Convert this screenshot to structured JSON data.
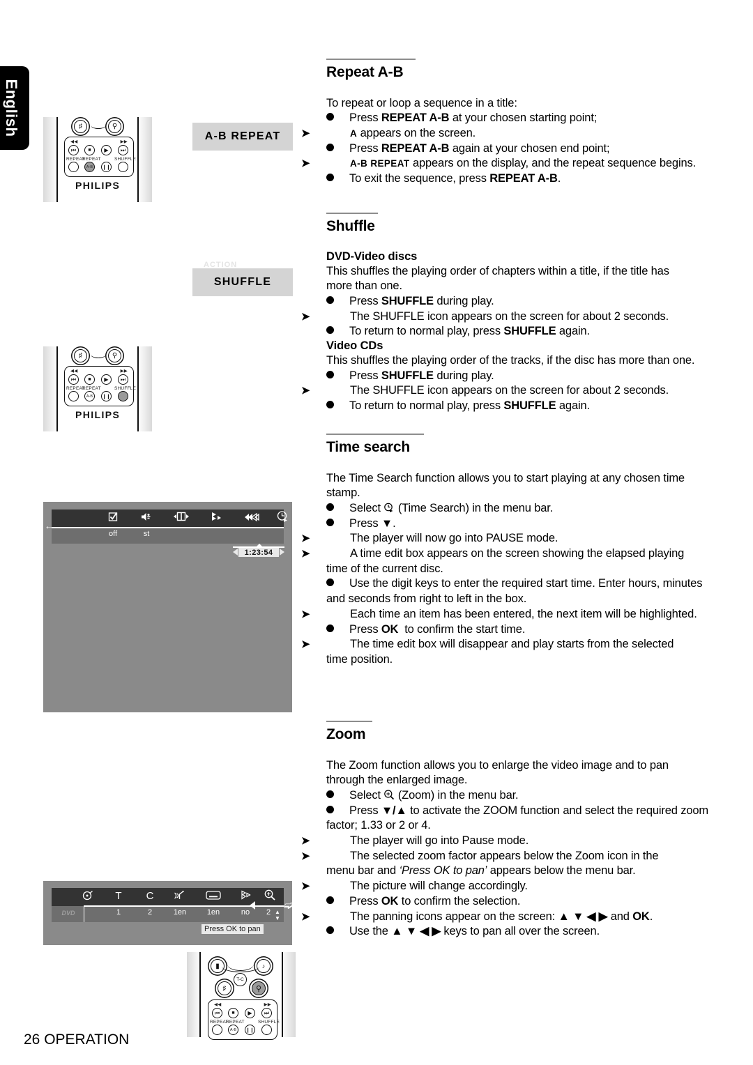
{
  "page": {
    "language_tab": "English",
    "footer": "26 OPERATION",
    "footer_page_number": "26",
    "footer_section": "OPERATION"
  },
  "sections": [
    {
      "id": "repeat-ab",
      "title": "Repeat A-B",
      "lines": [
        {
          "kind": "plain",
          "text": "To repeat or loop a sequence in a title:"
        },
        {
          "kind": "bullet",
          "text": "Press REPEAT A-B at your chosen starting point;",
          "bold": "REPEAT A-B"
        },
        {
          "kind": "arrow",
          "text": "A appears on the screen.",
          "smallcaps": "A"
        },
        {
          "kind": "bullet",
          "text": "Press REPEAT A-B again at your chosen end point;",
          "bold": "REPEAT A-B"
        },
        {
          "kind": "arrow",
          "text": "A-B REPEAT appears on the display, and the repeat sequence begins.",
          "smallcaps": "A-B REPEAT"
        },
        {
          "kind": "bullet",
          "text": "To exit the sequence, press REPEAT A-B.",
          "bold": "REPEAT A-B"
        }
      ]
    },
    {
      "id": "shuffle",
      "title": "Shuffle",
      "subheads": [
        "DVD-Video discs",
        "Video CDs"
      ],
      "lines": [
        {
          "kind": "subhead",
          "text": "DVD-Video discs"
        },
        {
          "kind": "plain",
          "text": "This shuffles the playing order of chapters within a title, if the title has"
        },
        {
          "kind": "plain",
          "text": "more than one."
        },
        {
          "kind": "bullet",
          "text": "Press SHUFFLE during play.",
          "bold": "SHUFFLE"
        },
        {
          "kind": "arrow",
          "text": "The SHUFFLE icon appears on the screen for about 2 seconds."
        },
        {
          "kind": "bullet",
          "text": "To return to normal play, press SHUFFLE again.",
          "bold": "SHUFFLE"
        },
        {
          "kind": "subhead",
          "text": "Video CDs"
        },
        {
          "kind": "plain",
          "text": "This shuffles the playing order of the tracks, if the disc has more  than one."
        },
        {
          "kind": "bullet",
          "text": "Press SHUFFLE during play.",
          "bold": "SHUFFLE"
        },
        {
          "kind": "arrow",
          "text": "The SHUFFLE icon appears on the screen for about 2 seconds."
        },
        {
          "kind": "bullet",
          "text": "To return to normal play, press SHUFFLE again.",
          "bold": "SHUFFLE"
        }
      ]
    },
    {
      "id": "time-search",
      "title": "Time search",
      "lines": [
        {
          "kind": "plain",
          "text": "The Time Search function allows you to start playing at any chosen time"
        },
        {
          "kind": "plain",
          "text": "stamp."
        },
        {
          "kind": "bullet",
          "text": "Select  (Time Search) in the menu bar.",
          "icon": "time-search-icon"
        },
        {
          "kind": "bullet",
          "text": "Press ▼."
        },
        {
          "kind": "arrow",
          "text": "The player will now go into PAUSE mode."
        },
        {
          "kind": "arrow",
          "text": "A time edit box appears on the screen showing the elapsed playing"
        },
        {
          "kind": "plain",
          "text": "time of the current disc."
        },
        {
          "kind": "bullet",
          "text": "Use the digit keys to enter the required start time. Enter hours, minutes"
        },
        {
          "kind": "plain",
          "text": "and seconds from right to left in the box."
        },
        {
          "kind": "arrow",
          "text": "Each time an item has been entered, the next item will be highlighted."
        },
        {
          "kind": "bullet",
          "text": "Press OK  to confirm the start time.",
          "bold": "OK"
        },
        {
          "kind": "arrow",
          "text": "The time edit box will disappear and play starts from the selected"
        },
        {
          "kind": "plain",
          "text": "time position."
        }
      ]
    },
    {
      "id": "zoom",
      "title": "Zoom",
      "lines": [
        {
          "kind": "plain",
          "text": "The Zoom function allows you to enlarge the video image and to pan"
        },
        {
          "kind": "plain",
          "text": "through the enlarged image."
        },
        {
          "kind": "bullet",
          "text": "Select  (Zoom) in the menu bar.",
          "icon": "zoom-icon"
        },
        {
          "kind": "bullet",
          "text": "Press ▼/▲ to activate the ZOOM function and select the required zoom"
        },
        {
          "kind": "plain",
          "text": "factor; 1.33 or 2 or 4."
        },
        {
          "kind": "arrow",
          "text": "The player will go into Pause mode."
        },
        {
          "kind": "arrow",
          "text": "The selected zoom factor appears below the Zoom icon in the"
        },
        {
          "kind": "plain",
          "text": "menu bar and ‘Press OK to pan’ appears below the menu bar.",
          "italic": "‘Press OK to pan’"
        },
        {
          "kind": "arrow",
          "text": "The picture will change accordingly."
        },
        {
          "kind": "bullet",
          "text": "Press OK to confirm the selection.",
          "bold": "OK"
        },
        {
          "kind": "arrow",
          "text": "The panning icons appear on the screen: ▲ ▼ ◀ ▶ and OK.",
          "bold": "OK"
        },
        {
          "kind": "bullet",
          "text": "Use the ▲ ▼ ◀ ▶ keys to pan all over the screen."
        }
      ]
    }
  ],
  "figures": {
    "remote_ab": {
      "brand": "PHILIPS",
      "key_labels": [
        "REPEAT",
        "REPEAT",
        "SHUFFLE"
      ],
      "ab_key_text": "A-B",
      "highlighted_key": "A-B",
      "top_row_glyphs": [
        "⏮",
        "■",
        "▶",
        "⏭"
      ],
      "rewind": "◀◀",
      "forward": "▶▶"
    },
    "chip_ab": {
      "label": "A-B  REPEAT"
    },
    "remote_shuffle": {
      "brand": "PHILIPS",
      "key_labels": [
        "REPEAT",
        "REPEAT",
        "SHUFFLE"
      ],
      "ab_key_text": "A-B",
      "highlighted_key": "SHUFFLE"
    },
    "chip_shuffle": {
      "label": "SHUFFLE",
      "ghost_label": "ACTION"
    },
    "screen_time": {
      "menu_icons": [
        "checkbox-icon",
        "speaker-icon",
        "screen-fit-icon",
        "angle-icon",
        "fast-forward-icon",
        "time-search-icon"
      ],
      "values": [
        "off",
        "st",
        "",
        "",
        "",
        ""
      ],
      "time_value": "1:23:54",
      "left_arrow": "←"
    },
    "screen_zoom": {
      "disc_label": "DVD",
      "menu_icons": [
        "title-disc-icon",
        "title-icon",
        "chapter-icon",
        "audio-icon",
        "subtitle-icon",
        "angle-icon",
        "zoom-icon"
      ],
      "values": [
        "",
        "1",
        "2",
        "1en",
        "1en",
        "no",
        "2"
      ],
      "zoom_value": "2",
      "press_ok_label": "Press OK to pan"
    },
    "remote_zoom": {
      "key_labels": [
        "REPEAT",
        "REPEAT",
        "SHUFFLE"
      ],
      "ab_key_text": "A-B",
      "tc_key_text": "T-C",
      "highlighted_key": "zoom"
    }
  },
  "colors": {
    "chip_bg": "#d4d4d4",
    "screen_bg": "#8a8a8a",
    "menubar_bg": "#333333",
    "subbar_bg": "#6e6e6e",
    "rule": "#8d8d8d",
    "tab_bg": "#000000",
    "highlight_key": "#9a9a9a"
  }
}
